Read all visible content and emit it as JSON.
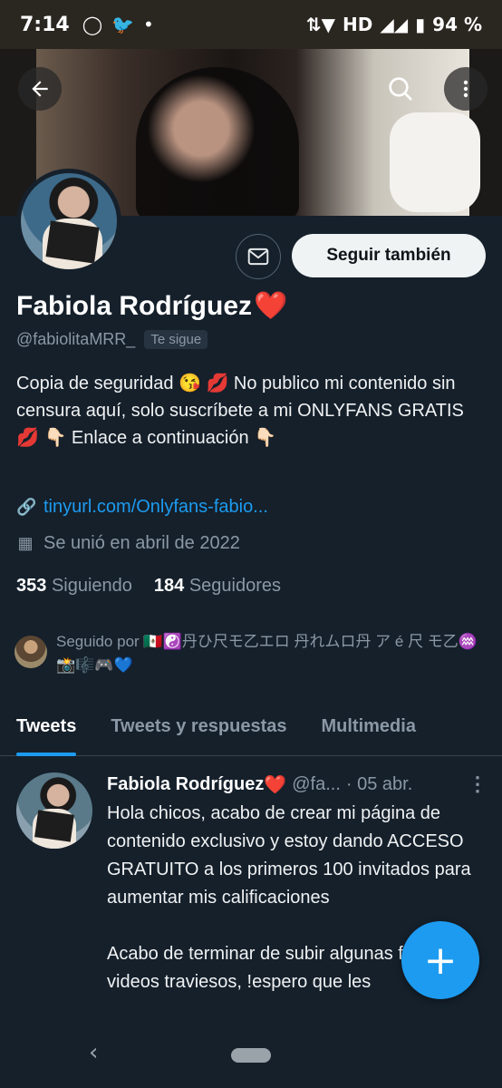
{
  "status_bar": {
    "time": "7:14",
    "icons": [
      "whatsapp-icon",
      "twitter-icon",
      "dot-icon"
    ],
    "network": "HD",
    "battery": "94 %"
  },
  "profile": {
    "name": "Fabiola Rodríguez",
    "name_emoji": "❤️",
    "handle": "@fabiolitaMRR_",
    "follows_you": "Te sigue",
    "follow_button": "Seguir también",
    "bio": "Copia de seguridad 😘 💋 No publico mi contenido sin censura aquí, solo suscríbete a mi ONLYFANS GRATIS 💋 👇🏻 Enlace a continuación 👇🏻",
    "link": "tinyurl.com/Onlyfans-fabio...",
    "joined": "Se unió en abril de 2022",
    "following_count": "353",
    "following_label": "Siguiendo",
    "followers_count": "184",
    "followers_label": "Seguidores",
    "followed_by": "Seguido por 🇲🇽☯️丹ひ尺モ乙エロ 丹れムロ丹 ア é 尺 モ乙♒📸🎼🎮💙"
  },
  "tabs": [
    {
      "label": "Tweets",
      "active": true
    },
    {
      "label": "Tweets y respuestas",
      "active": false
    },
    {
      "label": "Multimedia",
      "active": false
    }
  ],
  "tweet": {
    "name": "Fabiola Rodríguez",
    "name_emoji": "❤️",
    "handle": "@fa...",
    "date": "· 05 abr.",
    "more": "⋮",
    "text_1": "Hola chicos, acabo de crear mi página de contenido exclusivo y estoy dando ACCESO GRATUITO a los primeros 100 invitados para aumentar mis calificaciones",
    "text_2": "Acabo de terminar de subir algunas fotos y videos traviesos, !espero que les"
  },
  "fab_label": "+",
  "colors": {
    "accent": "#1d9bf0",
    "background": "#15202b",
    "heart": "#f4212e"
  }
}
